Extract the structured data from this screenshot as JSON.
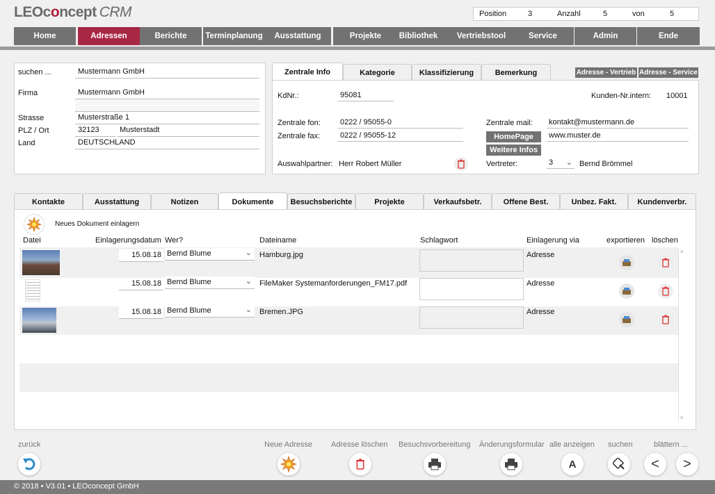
{
  "app": {
    "logo_main": "LEOconcept",
    "logo_red": "o",
    "logo_suffix": "CRM"
  },
  "record_nav": {
    "position_label": "Position",
    "position": "3",
    "count_label": "Anzahl",
    "count": "5",
    "of_label": "von",
    "of": "5"
  },
  "menu": [
    "Home",
    "Adressen",
    "Berichte",
    "Terminplanung",
    "Ausstattung",
    "Projekte",
    "Bibliothek",
    "Vertriebstool",
    "Service",
    "Admin",
    "Ende"
  ],
  "left": {
    "search_label": "suchen ...",
    "search_value": "Mustermann GmbH",
    "firma_label": "Firma",
    "firma_value": "Mustermann GmbH",
    "firma_value2": "",
    "strasse_label": "Strasse",
    "strasse_value": "Musterstraße 1",
    "plz_label": "PLZ / Ort",
    "plz_value": "32123",
    "ort_value": "Musterstadt",
    "land_label": "Land",
    "land_value": "DEUTSCHLAND"
  },
  "info_tabs": [
    "Zentrale Info",
    "Kategorie",
    "Klassifizierung",
    "Bemerkung"
  ],
  "addr_buttons": {
    "vertrieb": "Adresse - Vertrieb",
    "service": "Adresse - Service"
  },
  "info": {
    "kdnr_label": "KdNr.:",
    "kdnr": "95081",
    "intern_label": "Kunden-Nr.intern:",
    "intern": "10001",
    "fon_label": "Zentrale fon:",
    "fon": "0222 / 95055-0",
    "fax_label": "Zentrale fax:",
    "fax": "0222 / 95055-12",
    "mail_label": "Zentrale mail:",
    "mail": "kontakt@mustermann.de",
    "homepage_btn": "HomePage",
    "homepage": "www.muster.de",
    "more_btn": "Weitere Infos",
    "partner_label": "Auswahlpartner:",
    "partner": "Herr Robert Müller",
    "vertreter_label": "Vertreter:",
    "vertreter_nr": "3",
    "vertreter_name": "Bernd Brömmel"
  },
  "sub_tabs": [
    "Kontakte",
    "Ausstattung",
    "Notizen",
    "Dokumente",
    "Besuchsberichte",
    "Projekte",
    "Verkaufsbetr.",
    "Offene Best.",
    "Unbez. Fakt.",
    "Kundenverbr."
  ],
  "docs": {
    "new_label": "Neues Dokument einlagern",
    "headers": {
      "file": "Datei",
      "date": "Einlagerungsdatum",
      "who": "Wer?",
      "name": "Dateiname",
      "keyword": "Schlagwort",
      "via": "Einlagerung via",
      "export": "exportieren",
      "delete": "löschen"
    },
    "rows": [
      {
        "date": "15.08.18",
        "who": "Bernd Blume",
        "name": "Hamburg.jpg",
        "keyword": "",
        "via": "Adresse"
      },
      {
        "date": "15.08.18",
        "who": "Bernd Blume",
        "name": "FileMaker Systemanforderungen_FM17.pdf",
        "keyword": "",
        "via": "Adresse"
      },
      {
        "date": "15.08.18",
        "who": "Bernd Blume",
        "name": "Bremen.JPG",
        "keyword": "",
        "via": "Adresse"
      }
    ]
  },
  "bottom": {
    "back": "zurück",
    "new_address": "Neue Adresse",
    "delete_address": "Adresse löschen",
    "visit_prep": "Besuchsvorbereitung",
    "change_form": "Änderungsformular",
    "show_all": "alle anzeigen",
    "show_all_icon": "A",
    "search": "suchen",
    "browse": "blättern ..."
  },
  "footer": "© 2018 • V3.01 • LEOconcept GmbH",
  "colors": {
    "accent": "#a82745",
    "menu": "#727272",
    "bar": "#9a9a9a"
  }
}
